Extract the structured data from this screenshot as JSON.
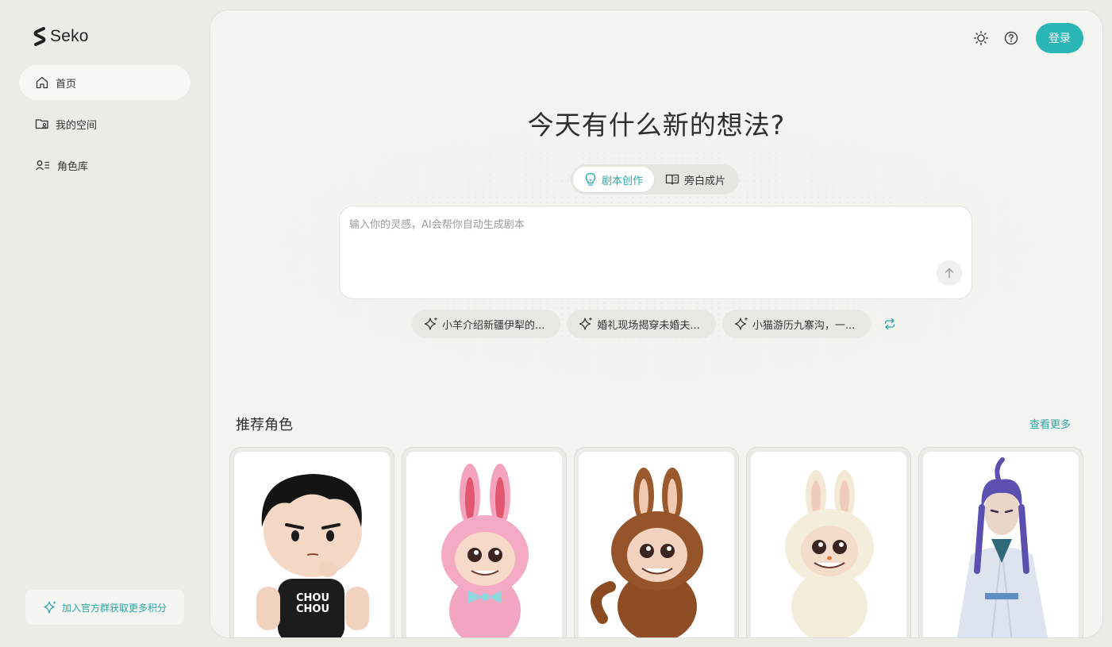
{
  "app": {
    "name": "Seko"
  },
  "nav": {
    "items": [
      {
        "label": "首页",
        "icon": "home-icon",
        "active": true
      },
      {
        "label": "我的空间",
        "icon": "folder-user-icon",
        "active": false
      },
      {
        "label": "角色库",
        "icon": "user-list-icon",
        "active": false
      }
    ]
  },
  "promo": {
    "label": "加入官方群获取更多积分",
    "icon": "sparkle-icon"
  },
  "header": {
    "login_label": "登录",
    "theme_icon": "sun-icon",
    "help_icon": "help-circle-icon"
  },
  "hero": {
    "title": "今天有什么新的想法?",
    "modes": [
      {
        "label": "剧本创作",
        "icon": "lightbulb-icon",
        "active": true
      },
      {
        "label": "旁白成片",
        "icon": "book-open-icon",
        "active": false
      }
    ],
    "prompt": {
      "placeholder": "输入你的灵感，AI会帮你自动生成剧本",
      "value": ""
    },
    "suggestions": [
      "小羊介绍新疆伊犁的...",
      "婚礼现场揭穿未婚夫...",
      "小猫游历九寨沟，一..."
    ]
  },
  "recommended": {
    "title": "推荐角色",
    "see_more": "查看更多",
    "cards": [
      {
        "character": "chibi-boy-black-hair",
        "shirt_text": "CHOU CHOU"
      },
      {
        "character": "pink-bunny-plush-toy"
      },
      {
        "character": "brown-bunny-plush-toy"
      },
      {
        "character": "cream-bunny-plush-toy"
      },
      {
        "character": "purple-haired-swordsman"
      }
    ]
  },
  "colors": {
    "accent": "#2bb6b6",
    "background": "#ecece7",
    "panel": "#f3f3ef"
  }
}
